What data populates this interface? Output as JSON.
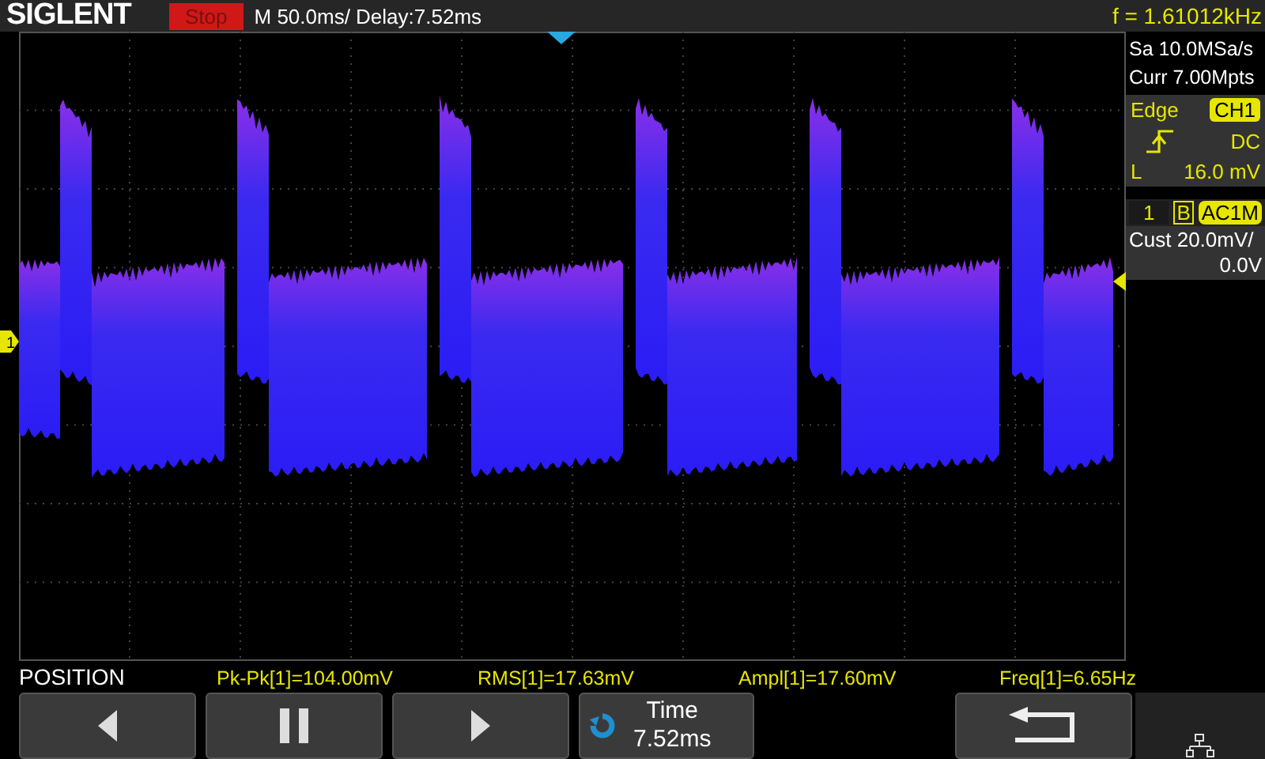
{
  "header": {
    "brand": "SIGLENT",
    "run_state": "Stop",
    "timebase": "M 50.0ms/ Delay:7.52ms",
    "frequency": "f = 1.61012kHz"
  },
  "acquisition": {
    "sample_rate": "Sa 10.0MSa/s",
    "memory_depth": "Curr 7.00Mpts"
  },
  "trigger": {
    "type": "Edge",
    "source": "CH1",
    "coupling": "DC",
    "level_label": "L",
    "level_value": "16.0 mV"
  },
  "channel": {
    "number": "1",
    "bandwidth_limit": "B",
    "coupling": "AC1M",
    "scale": "Cust 20.0mV/",
    "offset": "0.0V"
  },
  "markers": {
    "channel_marker": "1"
  },
  "menu_title": "POSITION",
  "measurements": [
    {
      "label": "Pk-Pk[1]=104.00mV"
    },
    {
      "label": "RMS[1]=17.63mV"
    },
    {
      "label": "Ampl[1]=17.60mV"
    },
    {
      "label": "Freq[1]=6.65Hz"
    }
  ],
  "softkeys": [
    {
      "kind": "left"
    },
    {
      "kind": "pause"
    },
    {
      "kind": "right"
    },
    {
      "kind": "value",
      "label": "Time",
      "value": "7.52ms"
    },
    {
      "kind": "empty"
    },
    {
      "kind": "back"
    }
  ]
}
